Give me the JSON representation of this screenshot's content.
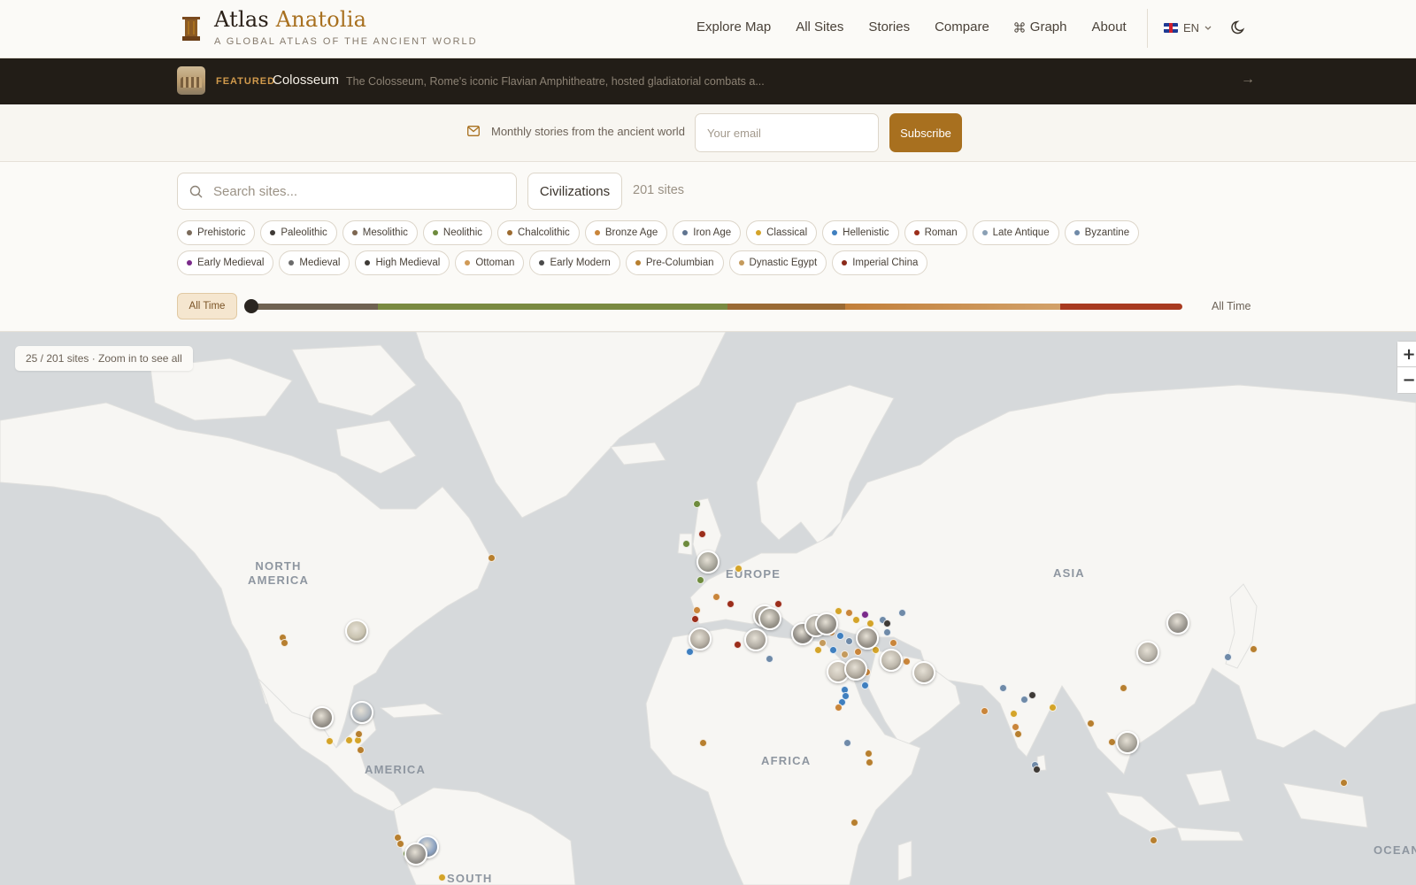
{
  "header": {
    "logo_title_main": "Atlas",
    "logo_title_accent": "Anatolia",
    "logo_subtitle": "A GLOBAL ATLAS OF THE ANCIENT WORLD",
    "nav": [
      "Explore Map",
      "All Sites",
      "Stories",
      "Compare",
      "Graph",
      "About"
    ],
    "lang": "EN"
  },
  "featured": {
    "tag": "FEATURED",
    "name": "Colosseum",
    "description": "The Colosseum, Rome's iconic Flavian Amphitheatre, hosted gladiatorial combats a..."
  },
  "newsletter": {
    "text": "Monthly stories from the ancient world",
    "email_placeholder": "Your email",
    "button": "Subscribe"
  },
  "filters": {
    "search_placeholder": "Search sites...",
    "civilizations_label": "Civilizations",
    "site_count": "201 sites",
    "periods_row1": [
      {
        "label": "Prehistoric",
        "color": "#7a6a5a"
      },
      {
        "label": "Paleolithic",
        "color": "#3e3a36"
      },
      {
        "label": "Mesolithic",
        "color": "#7d6650"
      },
      {
        "label": "Neolithic",
        "color": "#6e8b3d"
      },
      {
        "label": "Chalcolithic",
        "color": "#9c6b30"
      },
      {
        "label": "Bronze Age",
        "color": "#c9853a"
      },
      {
        "label": "Iron Age",
        "color": "#5f7490"
      },
      {
        "label": "Classical",
        "color": "#d4a429"
      },
      {
        "label": "Hellenistic",
        "color": "#3f7fbf"
      },
      {
        "label": "Roman",
        "color": "#9b2d1a"
      },
      {
        "label": "Late Antique",
        "color": "#8aa0b5"
      },
      {
        "label": "Byzantine",
        "color": "#6f8aa8"
      }
    ],
    "periods_row2": [
      {
        "label": "Early Medieval",
        "color": "#7a2a8a"
      },
      {
        "label": "Medieval",
        "color": "#6b6b6b"
      },
      {
        "label": "High Medieval",
        "color": "#3e3a36"
      },
      {
        "label": "Ottoman",
        "color": "#d09a56"
      },
      {
        "label": "Early Modern",
        "color": "#4a4a4a"
      },
      {
        "label": "Pre-Columbian",
        "color": "#b77f2f"
      },
      {
        "label": "Dynastic Egypt",
        "color": "#c49a5c"
      },
      {
        "label": "Imperial China",
        "color": "#8b2a1a"
      }
    ],
    "time_button": "All Time",
    "time_label": "All Time"
  },
  "map": {
    "count_text": "25 / 201 sites · Zoom in to see all",
    "zoom_in": "+",
    "zoom_out": "−",
    "regions": [
      "NORTH\nAMERICA",
      "EUROPE",
      "ASIA",
      "AMERICA",
      "AFRICA",
      "SOUTH",
      "OCEAN"
    ]
  }
}
